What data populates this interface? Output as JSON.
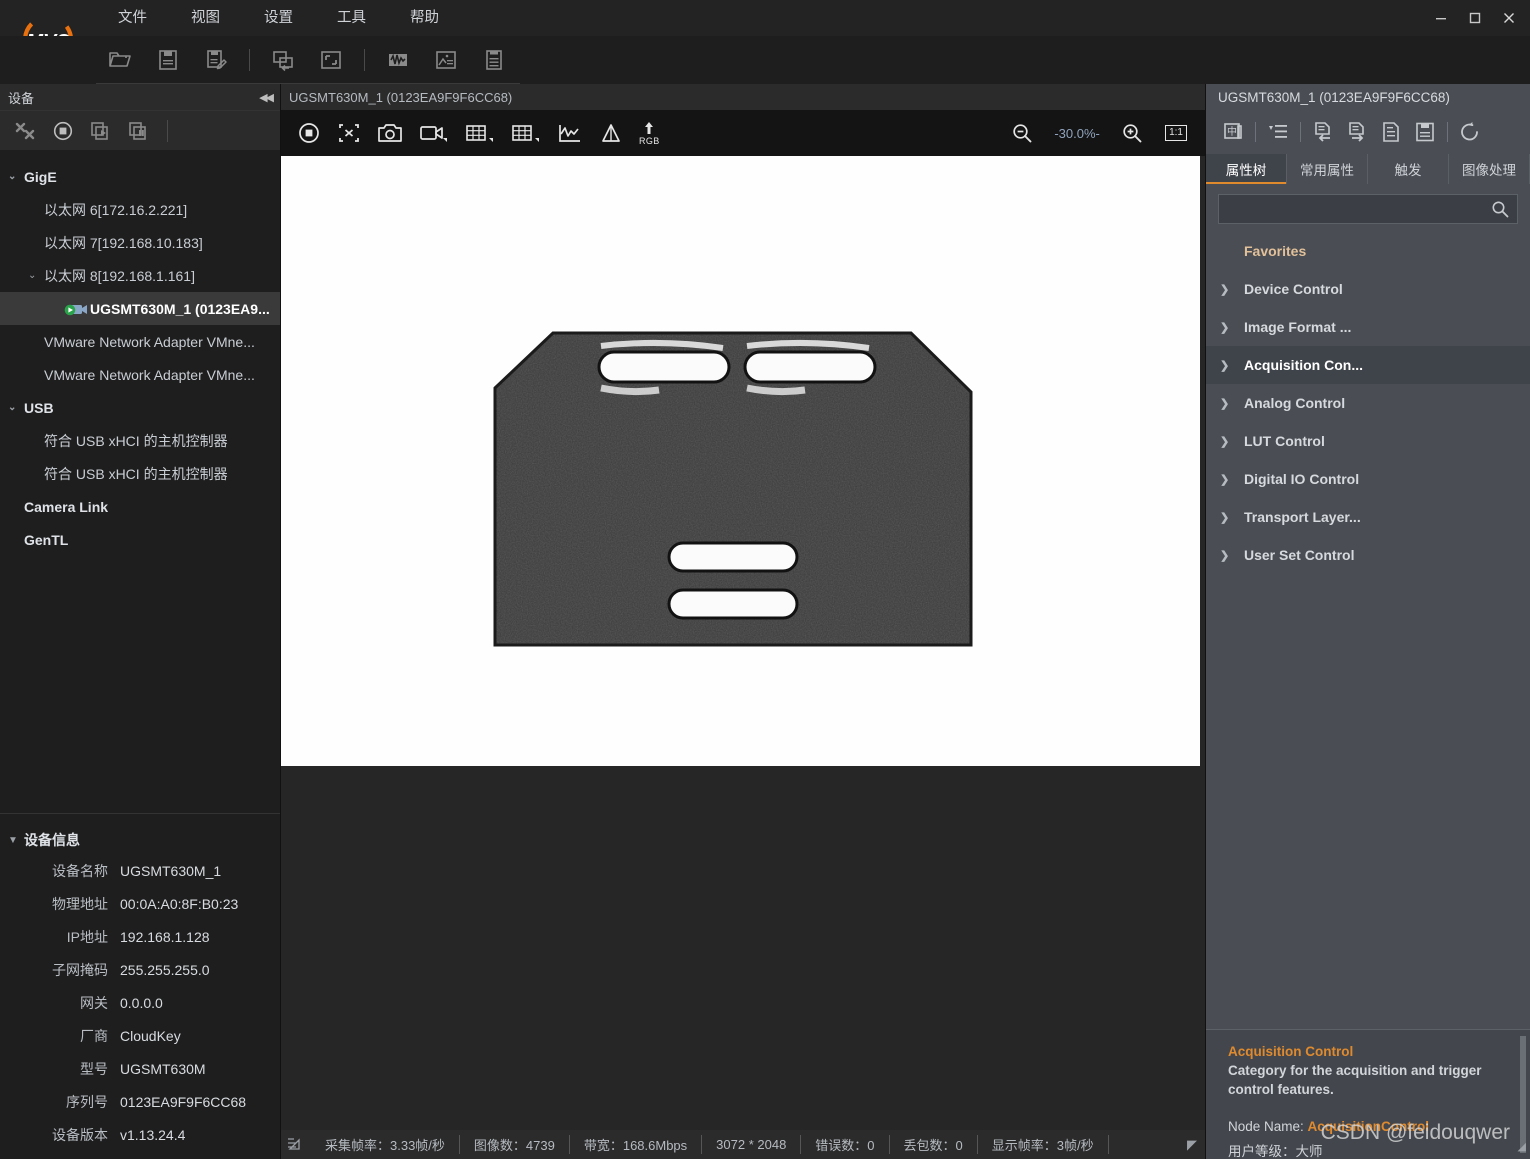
{
  "window": {
    "logo_text": "MVS",
    "minimize": "—",
    "maximize": "□",
    "close": "✕"
  },
  "menubar": {
    "items": [
      {
        "label": "文件",
        "name": "menu-file"
      },
      {
        "label": "视图",
        "name": "menu-view"
      },
      {
        "label": "设置",
        "name": "menu-settings"
      },
      {
        "label": "工具",
        "name": "menu-tools"
      },
      {
        "label": "帮助",
        "name": "menu-help"
      }
    ]
  },
  "toolbar": {
    "buttons": [
      {
        "icon": "open-folder-icon",
        "name": "open-file-button"
      },
      {
        "icon": "save-icon",
        "name": "save-button"
      },
      {
        "icon": "save-as-icon",
        "name": "save-as-button"
      },
      {
        "icon": "import-config-icon",
        "name": "import-config-button"
      },
      {
        "icon": "fullscreen-icon",
        "name": "fullscreen-button"
      },
      {
        "icon": "waveform-icon",
        "name": "waveform-button"
      },
      {
        "icon": "image-info-icon",
        "name": "image-info-button"
      },
      {
        "icon": "log-icon",
        "name": "log-button"
      }
    ]
  },
  "left_panel": {
    "header": "设备",
    "collapse_icon": "◀◀",
    "toolbar": [
      {
        "icon": "disconnect-icon",
        "name": "disconnect-device-button"
      },
      {
        "icon": "stop-icon",
        "name": "stop-acquisition-button"
      },
      {
        "icon": "start-all-icon",
        "name": "start-all-button"
      },
      {
        "icon": "pause-all-icon",
        "name": "pause-all-button"
      }
    ],
    "tree": [
      {
        "label": "GigE",
        "level": 0,
        "expanded": true,
        "selected": false,
        "camera": false
      },
      {
        "label": "以太网 6[172.16.2.221]",
        "level": 1,
        "expanded": null,
        "selected": false,
        "camera": false
      },
      {
        "label": "以太网 7[192.168.10.183]",
        "level": 1,
        "expanded": null,
        "selected": false,
        "camera": false
      },
      {
        "label": "以太网 8[192.168.1.161]",
        "level": 1,
        "expanded": true,
        "selected": false,
        "camera": false
      },
      {
        "label": "UGSMT630M_1 (0123EA9...",
        "level": 2,
        "expanded": null,
        "selected": true,
        "camera": true
      },
      {
        "label": "VMware Network Adapter VMne...",
        "level": 1,
        "expanded": null,
        "selected": false,
        "camera": false
      },
      {
        "label": "VMware Network Adapter VMne...",
        "level": 1,
        "expanded": null,
        "selected": false,
        "camera": false
      },
      {
        "label": "USB",
        "level": 0,
        "expanded": true,
        "selected": false,
        "camera": false
      },
      {
        "label": "符合 USB xHCI 的主机控制器",
        "level": 1,
        "expanded": null,
        "selected": false,
        "camera": false
      },
      {
        "label": "符合 USB xHCI 的主机控制器",
        "level": 1,
        "expanded": null,
        "selected": false,
        "camera": false
      },
      {
        "label": "Camera Link",
        "level": 0,
        "expanded": null,
        "selected": false,
        "camera": false
      },
      {
        "label": "GenTL",
        "level": 0,
        "expanded": null,
        "selected": false,
        "camera": false
      }
    ],
    "device_info": {
      "title": "设备信息",
      "expanded": true,
      "rows": [
        {
          "key": "设备名称",
          "value": "UGSMT630M_1"
        },
        {
          "key": "物理地址",
          "value": "00:0A:A0:8F:B0:23"
        },
        {
          "key": "IP地址",
          "value": "192.168.1.128"
        },
        {
          "key": "子网掩码",
          "value": "255.255.255.0"
        },
        {
          "key": "网关",
          "value": "0.0.0.0"
        },
        {
          "key": "厂商",
          "value": "CloudKey"
        },
        {
          "key": "型号",
          "value": "UGSMT630M"
        },
        {
          "key": "序列号",
          "value": "0123EA9F9F6CC68"
        },
        {
          "key": "设备版本",
          "value": "v1.13.24.4"
        }
      ]
    }
  },
  "viewer": {
    "title": "UGSMT630M_1 (0123EA9F9F6CC68)",
    "toolbar": [
      {
        "icon": "stop-record-icon",
        "name": "stop-grab-button"
      },
      {
        "icon": "fit-window-icon",
        "name": "fit-to-window-button"
      },
      {
        "icon": "camera-snapshot-icon",
        "name": "snapshot-button"
      },
      {
        "icon": "video-record-icon",
        "name": "record-video-button"
      },
      {
        "icon": "grid-cross-icon",
        "name": "crosshair-grid-button"
      },
      {
        "icon": "grid-icon",
        "name": "grid-button"
      },
      {
        "icon": "histogram-icon",
        "name": "histogram-button"
      },
      {
        "icon": "triangle-icon",
        "name": "pixel-peak-button"
      },
      {
        "icon": "rgb-upload-icon",
        "name": "rgb-button",
        "label": "RGB"
      }
    ],
    "zoom_out_icon": "zoom-out-icon",
    "zoom_in_icon": "zoom-in-icon",
    "zoom_level": "-30.0%-",
    "actual_size_label": "1:1"
  },
  "statusbar": {
    "cells": [
      {
        "label": "采集帧率：3.33帧/秒",
        "name": "status-acquisition-framerate"
      },
      {
        "label": "图像数：4739",
        "name": "status-frame-count"
      },
      {
        "label": "带宽：168.6Mbps",
        "name": "status-bandwidth"
      },
      {
        "label": "3072 * 2048",
        "name": "status-resolution"
      },
      {
        "label": "错误数：0",
        "name": "status-error-count"
      },
      {
        "label": "丢包数：0",
        "name": "status-packet-loss"
      },
      {
        "label": "显示帧率：3帧/秒",
        "name": "status-display-framerate"
      }
    ],
    "resize_grip": "◤"
  },
  "right_panel": {
    "title": "UGSMT630M_1 (0123EA9F9F6CC68)",
    "toolbar": [
      {
        "icon": "chinese-toggle-icon",
        "name": "language-toggle-button"
      },
      {
        "icon": "collapse-tree-icon",
        "name": "collapse-tree-button"
      },
      {
        "icon": "import-left-icon",
        "name": "load-feature-button"
      },
      {
        "icon": "export-right-icon",
        "name": "save-feature-button"
      },
      {
        "icon": "file-export-icon",
        "name": "export-file-button"
      },
      {
        "icon": "save-file-icon",
        "name": "save-file-button"
      },
      {
        "icon": "refresh-icon",
        "name": "refresh-button"
      }
    ],
    "tabs": [
      {
        "label": "属性树",
        "active": true,
        "name": "tab-property-tree"
      },
      {
        "label": "常用属性",
        "active": false,
        "name": "tab-common-properties"
      },
      {
        "label": "触发",
        "active": false,
        "name": "tab-trigger"
      },
      {
        "label": "图像处理",
        "active": false,
        "name": "tab-image-processing"
      }
    ],
    "search": {
      "value": "",
      "placeholder": "",
      "icon": "search-icon"
    },
    "tree": [
      {
        "label": "Favorites",
        "chevron": false,
        "selected": false
      },
      {
        "label": "Device Control",
        "chevron": true,
        "selected": false
      },
      {
        "label": "Image Format ...",
        "chevron": true,
        "selected": false
      },
      {
        "label": "Acquisition Con...",
        "chevron": true,
        "selected": true
      },
      {
        "label": "Analog Control",
        "chevron": true,
        "selected": false
      },
      {
        "label": "LUT Control",
        "chevron": true,
        "selected": false
      },
      {
        "label": "Digital IO Control",
        "chevron": true,
        "selected": false
      },
      {
        "label": "Transport Layer...",
        "chevron": true,
        "selected": false
      },
      {
        "label": "User Set Control",
        "chevron": true,
        "selected": false
      }
    ],
    "description": {
      "title": "Acquisition Control",
      "body": "Category for the acquisition and trigger control features.",
      "node_name_label": "Node Name: ",
      "node_name_value": "AcquisitionControl",
      "user_level_label": "用户等级：",
      "user_level_value": "大师"
    }
  },
  "watermark": "CSDN @feidouqwer",
  "colors": {
    "accent_orange": "#e08a2e",
    "left_bg": "#1e1e1e",
    "right_bg": "#4a4e54",
    "viewport_bg": "#262626",
    "image_bg": "#fefefe",
    "selected_row": "#3a3a3a",
    "status_text": "#b6bbc1"
  }
}
